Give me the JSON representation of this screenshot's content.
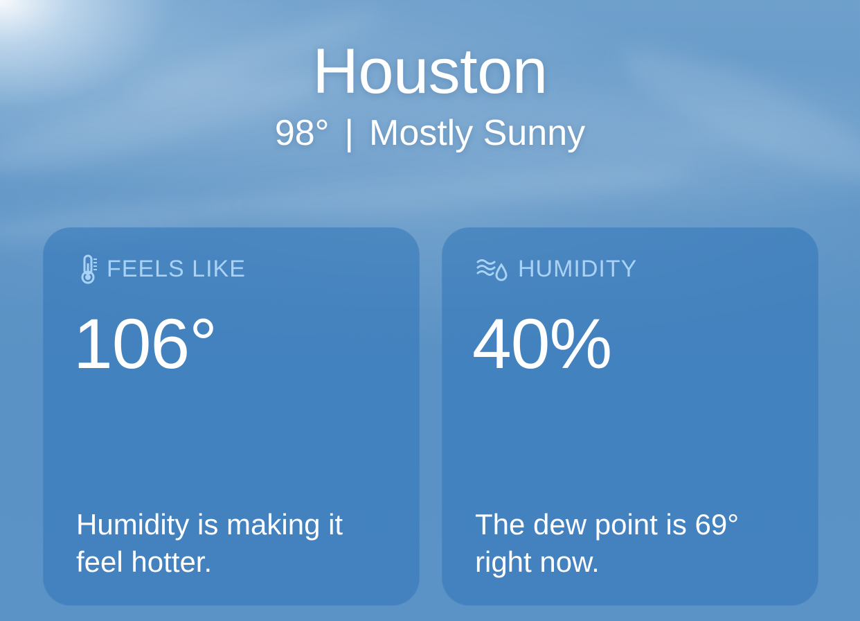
{
  "location": {
    "city": "Houston",
    "temperature": "98°",
    "separator": "|",
    "condition": "Mostly Sunny"
  },
  "cards": {
    "feels_like": {
      "icon": "thermometer-icon",
      "label": "FEELS LIKE",
      "value": "106°",
      "description": "Humidity is making it feel hotter."
    },
    "humidity": {
      "icon": "humidity-icon",
      "label": "HUMIDITY",
      "value": "40%",
      "description": "The dew point is 69° right now."
    }
  },
  "colors": {
    "sky": "#5f95c6",
    "card": "#3074b8",
    "label": "#a9d2f6",
    "text": "#ffffff"
  }
}
